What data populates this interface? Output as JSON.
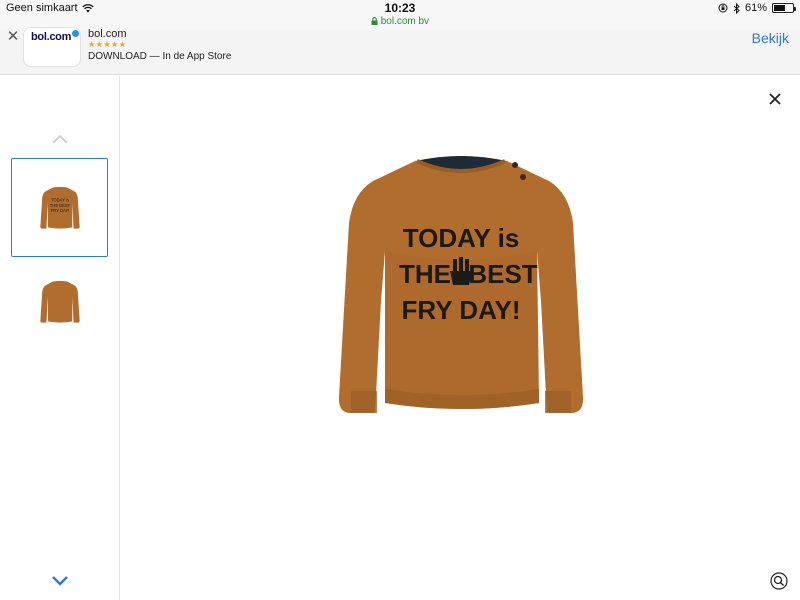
{
  "status_bar": {
    "carrier": "Geen simkaart",
    "time": "10:23",
    "url": "bol.com bv",
    "battery_percent": "61%",
    "battery_level": 0.61
  },
  "app_banner": {
    "icon_text": "bol.com",
    "app_name": "bol.com",
    "rating_stars": "★★★★★",
    "rating": 4.5,
    "subtitle": "DOWNLOAD — In de App Store",
    "view_label": "Bekijk"
  },
  "product_viewer": {
    "shirt_text_line1": "TODAY is",
    "shirt_text_line2_left": "THE",
    "shirt_text_line2_right": "BEST",
    "shirt_text_line3": "FRY DAY!",
    "shirt_color": "#b06d2d",
    "thumbnails": [
      {
        "label": "front view",
        "active": true
      },
      {
        "label": "back view",
        "active": false
      }
    ]
  },
  "colors": {
    "accent": "#2c7bd6",
    "secure_url": "#2e8b3a",
    "star": "#f3a21b"
  }
}
